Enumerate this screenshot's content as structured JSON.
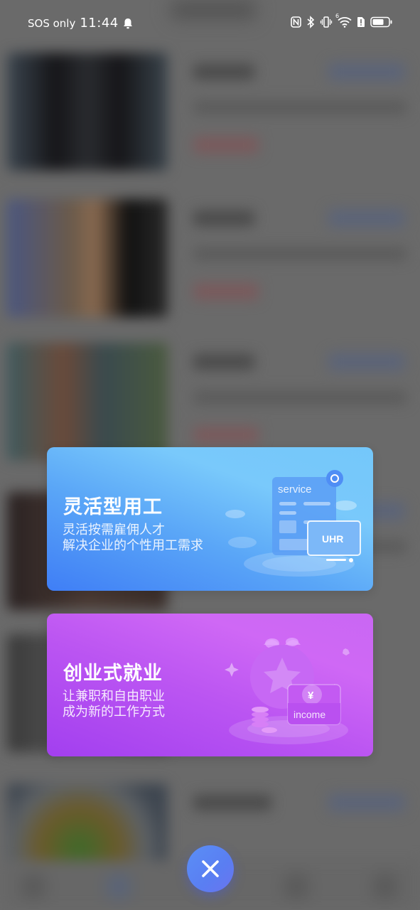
{
  "status_bar": {
    "carrier": "SOS only",
    "time": "11:44",
    "icons": [
      "bell-icon",
      "nfc-icon",
      "bluetooth-icon",
      "vibrate-icon",
      "wifi-icon",
      "sim-alert-icon",
      "battery-icon"
    ],
    "wifi_badge": "6"
  },
  "overlay": {
    "cards": [
      {
        "title": "灵活型用工",
        "subtitle_lines": [
          "灵活按需雇佣人才",
          "解决企业的个性用工需求"
        ],
        "illustration": {
          "header_text": "service",
          "screen_text": "UHR"
        },
        "accent": "#4f8ef6"
      },
      {
        "title": "创业式就业",
        "subtitle_lines": [
          "让兼职和自由职业",
          "成为新的工作方式"
        ],
        "illustration": {
          "coin_text": "¥",
          "wallet_text": "income"
        },
        "accent": "#b84ff0"
      }
    ],
    "close_button": {
      "icon": "close-icon",
      "color": "#5a86f4"
    }
  }
}
